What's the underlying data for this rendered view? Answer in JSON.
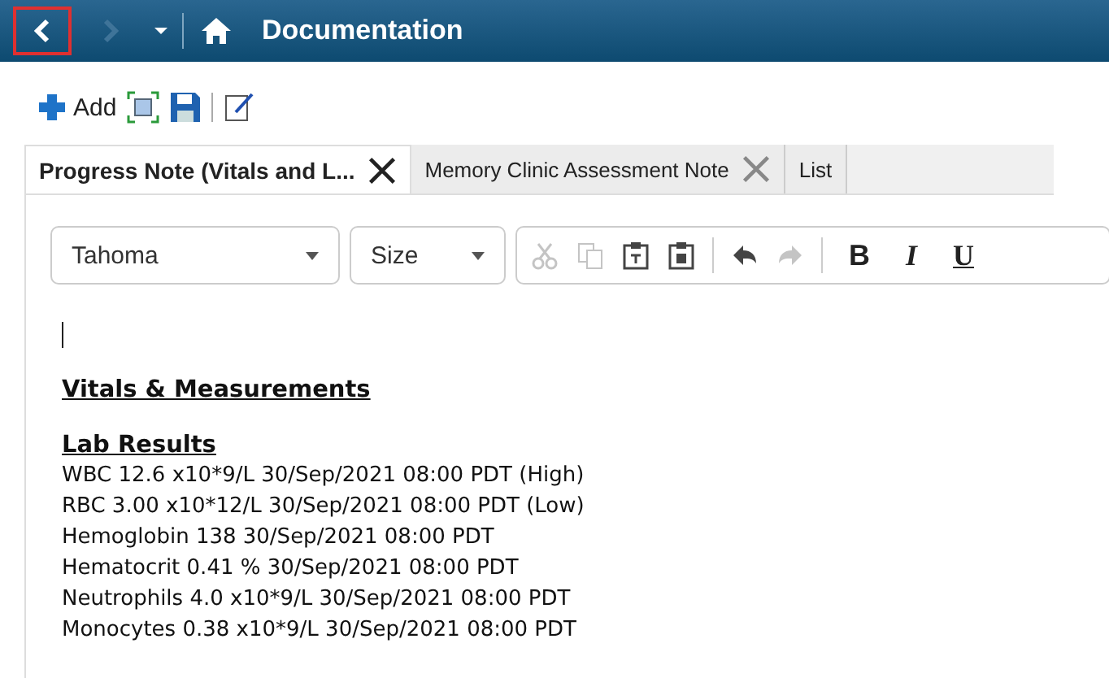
{
  "nav": {
    "back": {
      "focused": true,
      "disabled": false
    },
    "forward": {
      "focused": false,
      "disabled": true
    },
    "title": "Documentation"
  },
  "toolbar": {
    "add_label": "Add"
  },
  "tabs": [
    {
      "label": "Progress Note (Vitals and L...",
      "selected": true,
      "closable": true
    },
    {
      "label": "Memory Clinic Assessment Note",
      "selected": false,
      "closable": true
    },
    {
      "label": "List",
      "selected": false,
      "closable": false
    }
  ],
  "editor_toolbar": {
    "font": "Tahoma",
    "size": "Size",
    "tools": [
      {
        "kind": "cut",
        "disabled": true
      },
      {
        "kind": "copy",
        "disabled": true
      },
      {
        "kind": "paste",
        "disabled": false
      },
      {
        "kind": "paste-special",
        "disabled": false
      },
      {
        "kind": "sep"
      },
      {
        "kind": "undo",
        "disabled": false
      },
      {
        "kind": "redo",
        "disabled": true
      },
      {
        "kind": "sep"
      }
    ],
    "format_buttons": [
      "B",
      "I",
      "U"
    ]
  },
  "document": {
    "sections": [
      {
        "heading": "Vitals & Measurements"
      },
      {
        "heading": "Lab Results",
        "lines": [
          "WBC 12.6 x10*9/L 30/Sep/2021 08:00 PDT (High)",
          "RBC 3.00 x10*12/L 30/Sep/2021 08:00 PDT (Low)",
          "Hemoglobin 138 30/Sep/2021 08:00 PDT",
          "Hematocrit 0.41 % 30/Sep/2021 08:00 PDT",
          "Neutrophils 4.0 x10*9/L 30/Sep/2021 08:00 PDT",
          "Monocytes 0.38 x10*9/L 30/Sep/2021 08:00 PDT"
        ]
      }
    ]
  }
}
